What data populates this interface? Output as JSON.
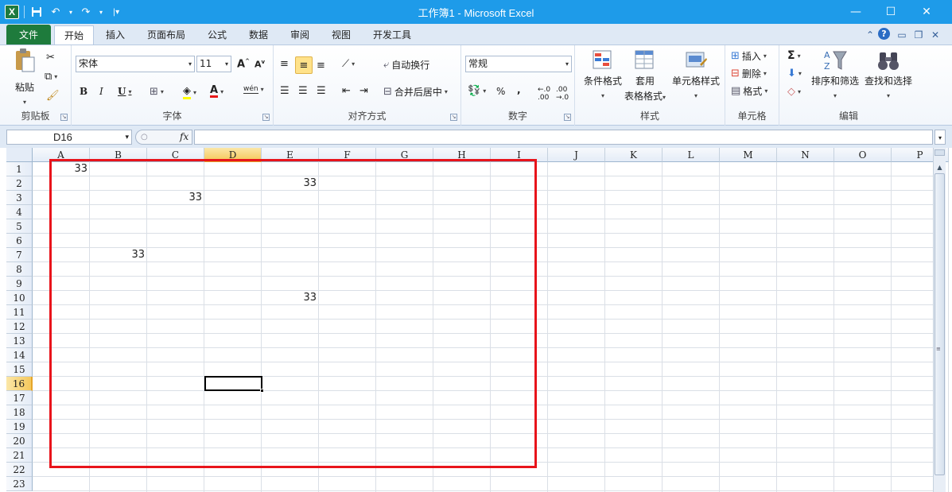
{
  "window": {
    "title": "工作簿1 - Microsoft Excel",
    "minimize": "—",
    "maximize": "☐",
    "close": "✕"
  },
  "qat": {
    "logo": "X",
    "save_icon": "save-icon",
    "undo_icon": "undo-icon",
    "redo_icon": "redo-icon"
  },
  "tabs": {
    "file": "文件",
    "items": [
      "开始",
      "插入",
      "页面布局",
      "公式",
      "数据",
      "审阅",
      "视图",
      "开发工具"
    ],
    "active": "开始"
  },
  "ribbon": {
    "clipboard": {
      "label": "剪贴板",
      "paste": "粘贴"
    },
    "font": {
      "label": "字体",
      "font_name": "宋体",
      "font_size": "11",
      "bold": "B",
      "italic": "I",
      "underline": "U",
      "phonetic": "wén"
    },
    "alignment": {
      "label": "对齐方式",
      "wrap_text": "自动换行",
      "merge_center": "合并后居中"
    },
    "number": {
      "label": "数字",
      "format": "常规",
      "percent": "%",
      "comma": ","
    },
    "styles": {
      "label": "样式",
      "conditional_formatting": "条件格式",
      "format_as_table_1": "套用",
      "format_as_table_2": "表格格式",
      "cell_styles": "单元格样式"
    },
    "cells": {
      "label": "单元格",
      "insert": "插入",
      "delete": "删除",
      "format": "格式"
    },
    "editing": {
      "label": "编辑",
      "autosum": "Σ",
      "sort_filter": "排序和筛选",
      "find_select": "查找和选择"
    }
  },
  "formula_bar": {
    "name_box": "D16",
    "fx": "fx",
    "content": ""
  },
  "grid": {
    "columns": [
      "A",
      "B",
      "C",
      "D",
      "E",
      "F",
      "G",
      "H",
      "I",
      "J",
      "K",
      "L",
      "M",
      "N",
      "O",
      "P"
    ],
    "rows": [
      "1",
      "2",
      "3",
      "4",
      "5",
      "6",
      "7",
      "8",
      "9",
      "10",
      "11",
      "12",
      "13",
      "14",
      "15",
      "16",
      "17",
      "18",
      "19",
      "20",
      "21",
      "22",
      "23"
    ],
    "selected_column": "D",
    "selected_row": "16",
    "cells": [
      {
        "ref": "A1",
        "value": "33"
      },
      {
        "ref": "E2",
        "value": "33"
      },
      {
        "ref": "C3",
        "value": "33"
      },
      {
        "ref": "B7",
        "value": "33"
      },
      {
        "ref": "E10",
        "value": "33"
      }
    ]
  },
  "colors": {
    "titlebar": "#1e9be9",
    "file_tab": "#1e7b3c",
    "highlight_box": "#e8141b",
    "selected_header": "#f5c85c"
  }
}
